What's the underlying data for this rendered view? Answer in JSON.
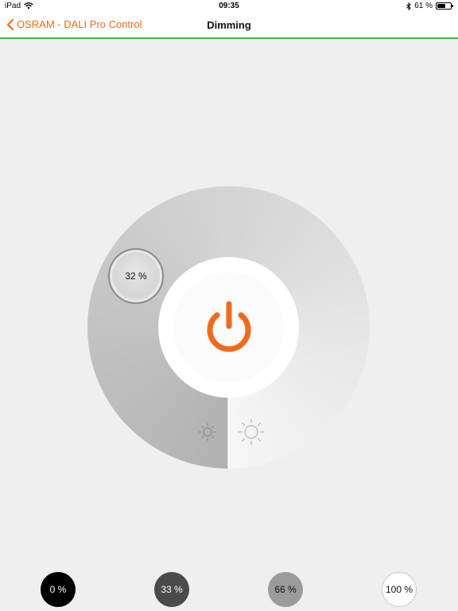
{
  "status_bar": {
    "device": "iPad",
    "time": "09:35",
    "battery_text": "61 %",
    "battery_level": 0.61
  },
  "nav": {
    "back_label": "OSRAM - DALI Pro Control",
    "title": "Dimming"
  },
  "dimmer": {
    "level_label": "32 %",
    "level_value": 32,
    "accent_color": "#f06a1c"
  },
  "presets": [
    {
      "label": "0 %",
      "bg": "#000000",
      "fg": "#ffffff"
    },
    {
      "label": "33 %",
      "bg": "#4a4a4a",
      "fg": "#ffffff"
    },
    {
      "label": "66 %",
      "bg": "#9b9b9b",
      "fg": "#111111"
    },
    {
      "label": "100 %",
      "bg": "#ffffff",
      "fg": "#111111"
    }
  ],
  "colors": {
    "nav_accent_line": "#3cb44a",
    "background": "#efefef"
  }
}
